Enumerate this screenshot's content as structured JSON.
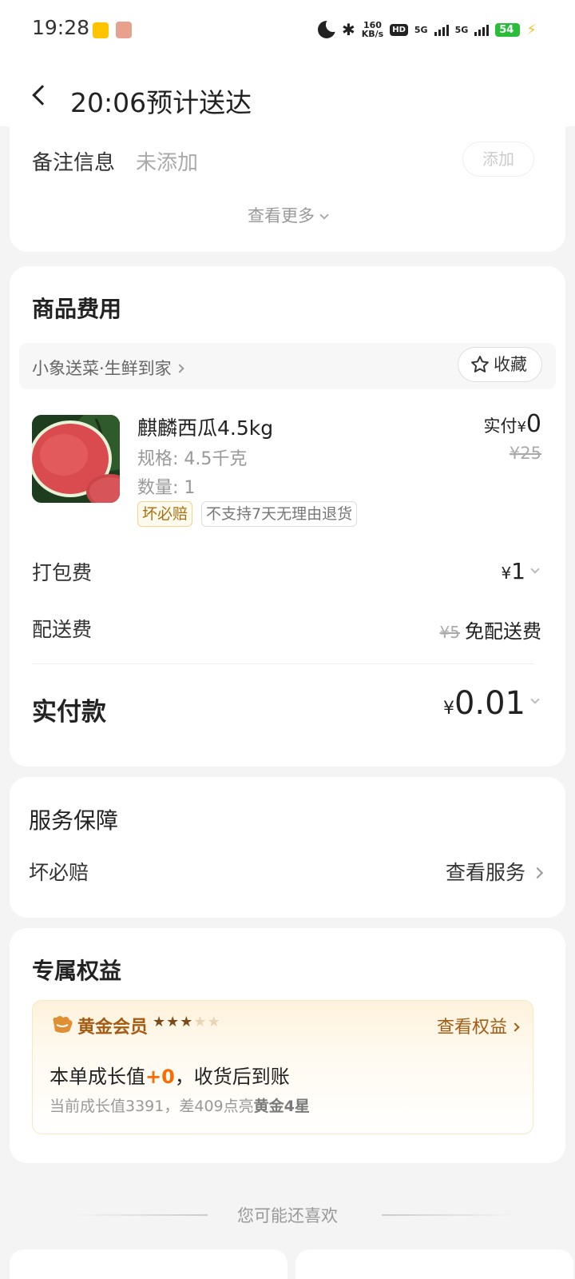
{
  "status_bar": {
    "time": "19:28",
    "speed_value": "160",
    "speed_unit": "KB/s",
    "hd": "HD",
    "net1": "5G",
    "net2": "5G",
    "battery": "54"
  },
  "header": {
    "title": "20:06预计送达"
  },
  "remarks": {
    "label": "备注信息",
    "value": "未添加",
    "add_button": "添加",
    "see_more": "查看更多"
  },
  "fees": {
    "title": "商品费用",
    "store_name": "小象送菜·生鲜到家",
    "favorite_button": "收藏",
    "product": {
      "name": "麒麟西瓜4.5kg",
      "spec": "规格: 4.5千克",
      "quantity": "数量: 1",
      "tag_guarantee": "坏必赔",
      "tag_no_return": "不支持7天无理由退货",
      "paid_label": "实付",
      "paid_currency": "¥",
      "paid_amount": "0",
      "original_price": "¥25"
    },
    "packing": {
      "label": "打包费",
      "currency": "¥",
      "amount": "1"
    },
    "delivery": {
      "label": "配送费",
      "original": "¥5",
      "value": "免配送费"
    },
    "total": {
      "label": "实付款",
      "currency": "¥",
      "amount": "0.01"
    }
  },
  "service": {
    "title": "服务保障",
    "item_label": "坏必赔",
    "link": "查看服务"
  },
  "benefits": {
    "title": "专属权益",
    "member_level": "黄金会员",
    "stars_filled": 3,
    "stars_total": 5,
    "link": "查看权益",
    "growth_prefix": "本单成长值",
    "growth_value": "+0",
    "growth_suffix": "，收货后到账",
    "current_text": "当前成长值3391，差409点亮",
    "next_level": "黄金4星"
  },
  "recommend": {
    "title": "您可能还喜欢"
  },
  "colors": {
    "accent_orange": "#ff6a00",
    "gold_text": "#a55b12",
    "battery_green": "#2bbd3a"
  }
}
